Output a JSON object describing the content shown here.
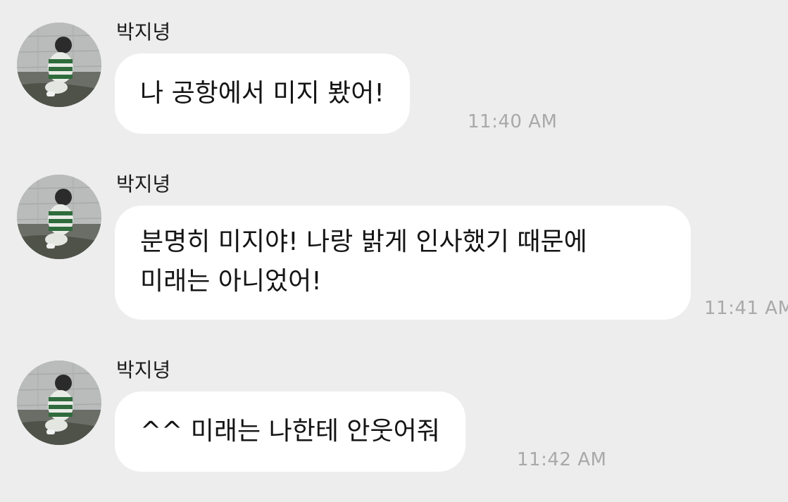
{
  "messages": [
    {
      "sender": "박지녕",
      "lines": [
        "나 공항에서 미지 봤어!"
      ],
      "time": "11:40 AM"
    },
    {
      "sender": "박지녕",
      "lines": [
        "분명히 미지야! 나랑 밝게 인사했기 때문에",
        "미래는 아니었어!"
      ],
      "time": "11:41 AM"
    },
    {
      "sender": "박지녕",
      "lines": [
        "^^ 미래는 나한테 안웃어줘"
      ],
      "time": "11:42 AM"
    }
  ],
  "colors": {
    "background": "#ededed",
    "bubble": "#ffffff",
    "timestamp": "#a9a9a9"
  }
}
